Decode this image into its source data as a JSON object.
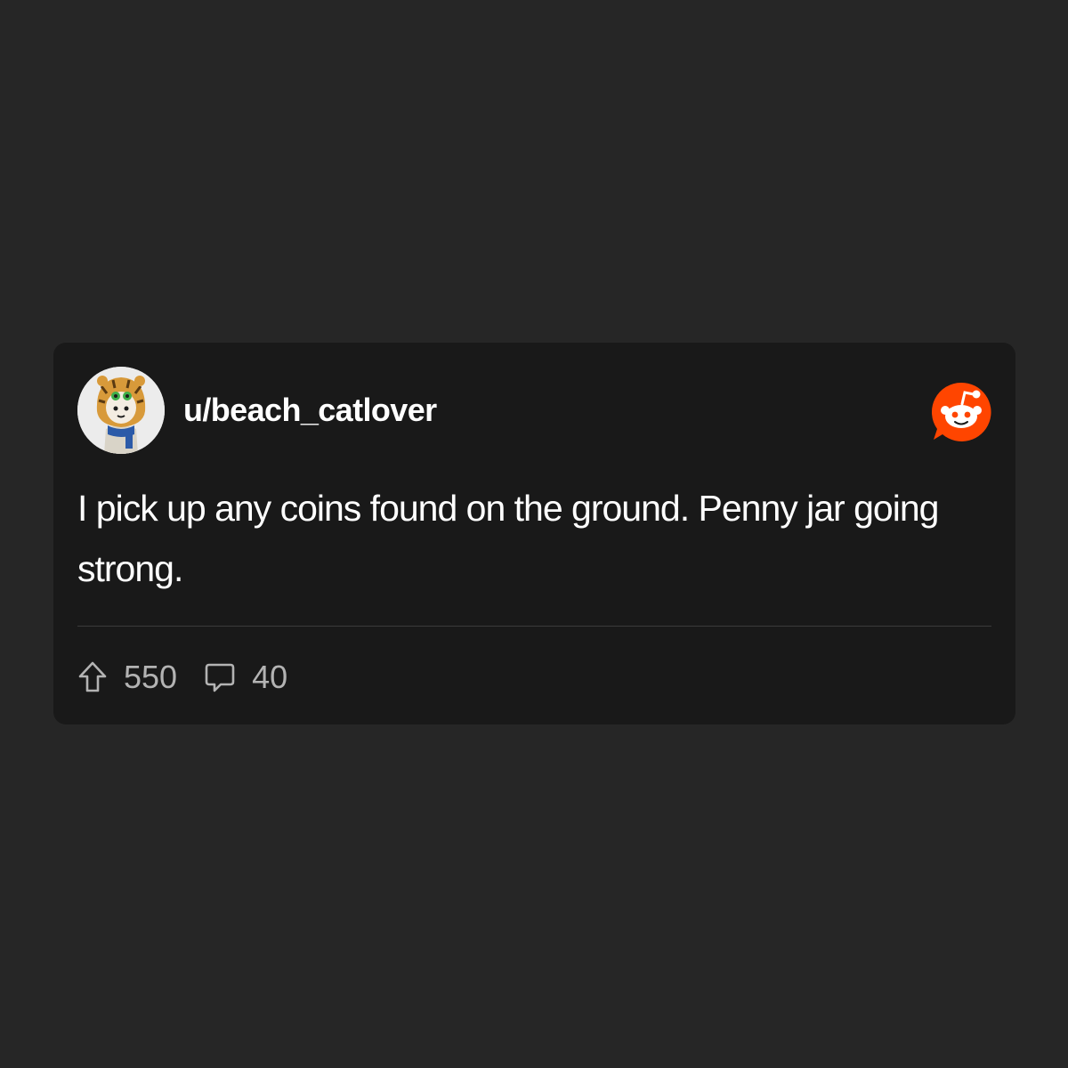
{
  "post": {
    "username": "u/beach_catlover",
    "body": "I pick up any coins found on the ground. Penny jar going strong.",
    "upvotes": "550",
    "comments": "40"
  },
  "icons": {
    "avatar": "user-avatar",
    "brand": "reddit-logo-icon",
    "upvote": "upvote-arrow-icon",
    "comment": "comment-bubble-icon"
  },
  "colors": {
    "page_background": "#262626",
    "card_background": "#191919",
    "brand_orange": "#ff4500",
    "text_primary": "#ffffff",
    "text_secondary": "#b3b3b3"
  }
}
